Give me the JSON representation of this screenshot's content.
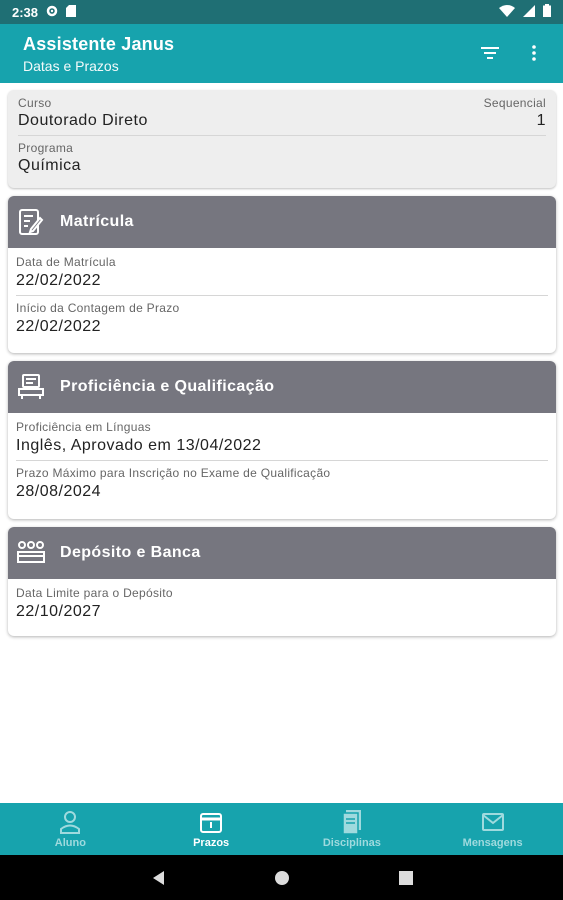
{
  "status_bar": {
    "time": "2:38"
  },
  "app_bar": {
    "title": "Assistente Janus",
    "subtitle": "Datas e Prazos"
  },
  "info": {
    "curso_label": "Curso",
    "curso_value": "Doutorado Direto",
    "sequencial_label": "Sequencial",
    "sequencial_value": "1",
    "programa_label": "Programa",
    "programa_value": "Química"
  },
  "sections": [
    {
      "title": "Matrícula",
      "icon": "form-edit-icon",
      "fields": [
        {
          "label": "Data de Matrícula",
          "value": "22/02/2022"
        },
        {
          "label": "Início da Contagem de Prazo",
          "value": "22/02/2022"
        }
      ]
    },
    {
      "title": "Proficiência e Qualificação",
      "icon": "certificate-icon",
      "fields": [
        {
          "label": "Proficiência em Línguas",
          "value": "Inglês, Aprovado em 13/04/2022"
        },
        {
          "label": "Prazo Máximo para Inscrição no Exame de Qualificação",
          "value": "28/08/2024"
        }
      ]
    },
    {
      "title": "Depósito e Banca",
      "icon": "committee-icon",
      "fields": [
        {
          "label": "Data Limite para o Depósito",
          "value": "22/10/2027"
        }
      ]
    }
  ],
  "bottom_nav": [
    {
      "label": "Aluno",
      "icon": "person-icon",
      "active": false
    },
    {
      "label": "Prazos",
      "icon": "calendar-icon",
      "active": true
    },
    {
      "label": "Disciplinas",
      "icon": "books-icon",
      "active": false
    },
    {
      "label": "Mensagens",
      "icon": "mail-icon",
      "active": false
    }
  ],
  "colors": {
    "status_bar": "#1f6f74",
    "primary": "#17a3ad",
    "section_header": "#76767f",
    "nav_inactive": "#9fdade"
  }
}
